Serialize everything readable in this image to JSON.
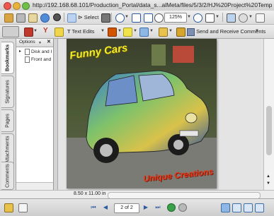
{
  "window": {
    "title": "http://192.168.68.101/Production_Portal/data_s...alMeta/files/5/3/2/HJ%20Project%20Template.pdf"
  },
  "toolbar1": {
    "select_label": "Select",
    "zoom_value": "125%"
  },
  "toolbar2": {
    "text_edits_label": "Text Edits",
    "send_receive_label": "Send and Receive Comments"
  },
  "sidetabs": [
    "Bookmarks",
    "Signatures",
    "Pages",
    "Attachments",
    "Comments"
  ],
  "bookmarks": {
    "options_label": "Options",
    "close_glyph": "✕",
    "items": [
      "Disk and I",
      "Front and"
    ]
  },
  "document": {
    "title_text": "Funny Cars",
    "bottom_text": "Unique Creations",
    "page_size": "8.50 x 11.00 in"
  },
  "navigation": {
    "page_display": "2 of 2"
  },
  "colors": {
    "accent": "#2c5aa0",
    "title_yellow": "#f2ec2a",
    "bottom_red": "#e03a1c",
    "bookmark_tab_active": "#fafafa"
  },
  "icons": [
    "close-window-icon",
    "minimize-icon",
    "zoom-window-icon",
    "open-icon",
    "print-icon",
    "email-icon",
    "search-icon",
    "hand-tool-icon",
    "select-tool-icon",
    "zoom-in-icon",
    "zoom-out-icon",
    "fit-page-icon",
    "fit-width-icon",
    "export-icon",
    "sticky-note-icon",
    "pen-icon",
    "highlight-icon",
    "stamp-icon",
    "attach-icon",
    "tag-icon",
    "first-page-icon",
    "prev-page-icon",
    "next-page-icon",
    "last-page-icon"
  ]
}
